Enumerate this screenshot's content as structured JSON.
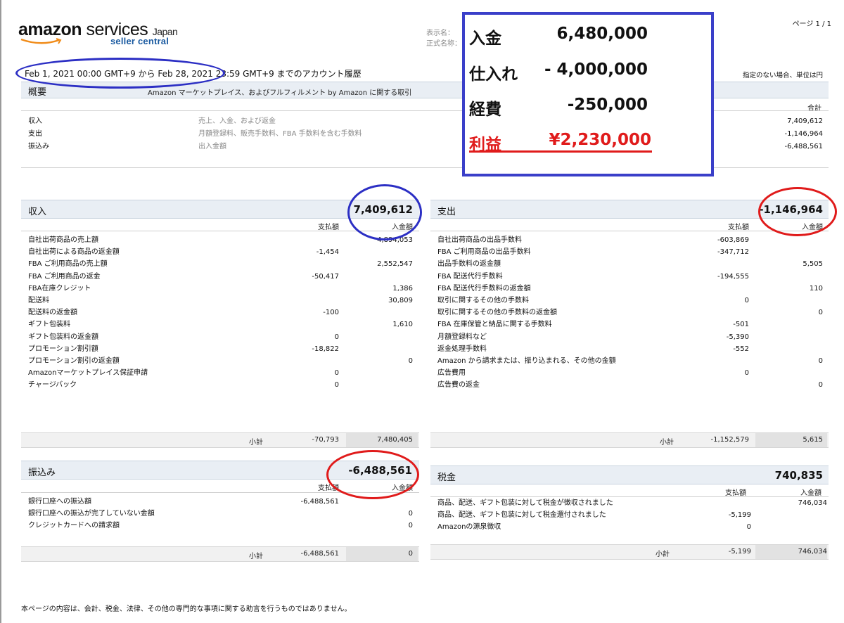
{
  "logo": {
    "brand": "amazon",
    "services": "services",
    "region": "Japan",
    "sub": "seller central"
  },
  "header": {
    "page_label": "ページ 1 / 1",
    "display_name_label": "表示名：",
    "official_name_label": "正式名称：",
    "period": "Feb 1, 2021 00:00 GMT+9 から Feb 28, 2021 23:59 GMT+9 までのアカウント履歴",
    "unit_note": "指定のない場合、単位は円"
  },
  "overview": {
    "title": "概要",
    "subtitle": "Amazon マーケットプレイス、およびフルフィルメント by Amazon に関する取引",
    "total_label": "合計",
    "rows": [
      {
        "label": "収入",
        "desc": "売上、入金、および返金",
        "value": "7,409,612"
      },
      {
        "label": "支出",
        "desc": "月額登録料、販売手数料、FBA 手数料を含む手数料",
        "value": "-1,146,964"
      },
      {
        "label": "振込み",
        "desc": "出入金額",
        "value": "-6,488,561"
      }
    ]
  },
  "income": {
    "title": "収入",
    "total": "7,409,612",
    "col1": "支払額",
    "col2": "入金額",
    "rows": [
      {
        "label": "自社出荷商品の売上額",
        "c1": "",
        "c2": "4,894,053"
      },
      {
        "label": "自社出荷による商品の返金額",
        "c1": "-1,454",
        "c2": ""
      },
      {
        "label": "FBA ご利用商品の売上額",
        "c1": "",
        "c2": "2,552,547"
      },
      {
        "label": "FBA ご利用商品の返金",
        "c1": "-50,417",
        "c2": ""
      },
      {
        "label": "FBA在庫クレジット",
        "c1": "",
        "c2": "1,386"
      },
      {
        "label": "配送料",
        "c1": "",
        "c2": "30,809"
      },
      {
        "label": "配送料の返金額",
        "c1": "-100",
        "c2": ""
      },
      {
        "label": "ギフト包装料",
        "c1": "",
        "c2": "1,610"
      },
      {
        "label": "ギフト包装料の返金額",
        "c1": "0",
        "c2": ""
      },
      {
        "label": "プロモーション割引額",
        "c1": "-18,822",
        "c2": ""
      },
      {
        "label": "プロモーション割引の返金額",
        "c1": "",
        "c2": "0"
      },
      {
        "label": "Amazonマーケットプレイス保証申請",
        "c1": "0",
        "c2": ""
      },
      {
        "label": "チャージバック",
        "c1": "0",
        "c2": ""
      }
    ],
    "subtotal_label": "小計",
    "subtotal_c1": "-70,793",
    "subtotal_c2": "7,480,405"
  },
  "expense": {
    "title": "支出",
    "total": "-1,146,964",
    "col1": "支払額",
    "col2": "入金額",
    "rows": [
      {
        "label": "自社出荷商品の出品手数料",
        "c1": "-603,869",
        "c2": ""
      },
      {
        "label": "FBA ご利用商品の出品手数料",
        "c1": "-347,712",
        "c2": ""
      },
      {
        "label": "出品手数料の返金額",
        "c1": "",
        "c2": "5,505"
      },
      {
        "label": "FBA 配送代行手数料",
        "c1": "-194,555",
        "c2": ""
      },
      {
        "label": "FBA 配送代行手数料の返金額",
        "c1": "",
        "c2": "110"
      },
      {
        "label": "取引に関するその他の手数料",
        "c1": "0",
        "c2": ""
      },
      {
        "label": "取引に関するその他の手数料の返金額",
        "c1": "",
        "c2": "0"
      },
      {
        "label": "FBA 在庫保管と納品に関する手数料",
        "c1": "-501",
        "c2": ""
      },
      {
        "label": "月額登録料など",
        "c1": "-5,390",
        "c2": ""
      },
      {
        "label": "返金処理手数料",
        "c1": "-552",
        "c2": ""
      },
      {
        "label": "Amazon から請求または、振り込まれる、その他の金額",
        "c1": "",
        "c2": "0"
      },
      {
        "label": "広告費用",
        "c1": "0",
        "c2": ""
      },
      {
        "label": "広告費の返金",
        "c1": "",
        "c2": "0"
      }
    ],
    "subtotal_label": "小計",
    "subtotal_c1": "-1,152,579",
    "subtotal_c2": "5,615"
  },
  "transfer": {
    "title": "振込み",
    "total": "-6,488,561",
    "col1": "支払額",
    "col2": "入金額",
    "rows": [
      {
        "label": "銀行口座への振込額",
        "c1": "-6,488,561",
        "c2": ""
      },
      {
        "label": "銀行口座への振込が完了していない金額",
        "c1": "",
        "c2": "0"
      },
      {
        "label": "クレジットカードへの請求額",
        "c1": "",
        "c2": "0"
      }
    ],
    "subtotal_label": "小計",
    "subtotal_c1": "-6,488,561",
    "subtotal_c2": "0"
  },
  "tax": {
    "title": "税金",
    "total": "740,835",
    "col1": "支払額",
    "col2": "入金額",
    "rows": [
      {
        "label": "商品、配送、ギフト包装に対して税金が徴収されました",
        "c1": "",
        "c2": "746,034"
      },
      {
        "label": "商品、配送、ギフト包装に対して税金還付されました",
        "c1": "-5,199",
        "c2": ""
      },
      {
        "label": "Amazonの源泉徴収",
        "c1": "0",
        "c2": ""
      }
    ],
    "subtotal_label": "小計",
    "subtotal_c1": "-5,199",
    "subtotal_c2": "746,034"
  },
  "summary_box": {
    "rows": [
      {
        "label": "入金",
        "value": "6,480,000"
      },
      {
        "label": "仕入れ",
        "value": "- 4,000,000"
      },
      {
        "label": "経費",
        "value": "-250,000"
      },
      {
        "label": "利益",
        "value": "¥2,230,000"
      }
    ]
  },
  "footer": {
    "disclaimer": "本ページの内容は、会計、税金、法律、その他の専門的な事項に関する助言を行うものではありません。"
  },
  "colors": {
    "overlay_border": "#3a3fc9",
    "highlight_red": "#e01b1b",
    "highlight_blue": "#2c2fc4",
    "section_bar": "#e9eef4"
  }
}
